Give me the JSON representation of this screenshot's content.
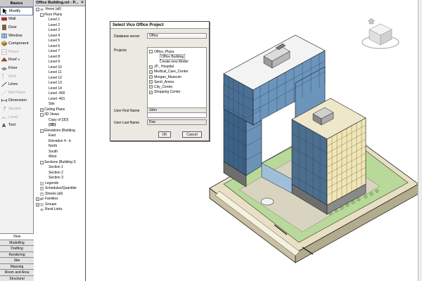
{
  "palette": {
    "header": "Basics",
    "tools": [
      {
        "label": "Modify",
        "icon": "modify-arrow-icon",
        "selected": true,
        "disabled": false
      },
      {
        "label": "Wall",
        "icon": "wall-icon",
        "selected": false,
        "disabled": false
      },
      {
        "label": "Door",
        "icon": "door-icon",
        "selected": false,
        "disabled": false
      },
      {
        "label": "Window",
        "icon": "window-icon",
        "selected": false,
        "disabled": false
      },
      {
        "label": "Component",
        "icon": "component-icon",
        "selected": false,
        "disabled": false
      },
      {
        "label": "Room",
        "icon": "room-icon",
        "selected": false,
        "disabled": true
      },
      {
        "label": "Roof »",
        "icon": "roof-icon",
        "selected": false,
        "disabled": false
      },
      {
        "label": "Floor",
        "icon": "floor-icon",
        "selected": false,
        "disabled": false
      },
      {
        "label": "Grid",
        "icon": "grid-icon",
        "selected": false,
        "disabled": true
      },
      {
        "label": "Lines",
        "icon": "lines-icon",
        "selected": false,
        "disabled": false
      },
      {
        "label": "Ref Plane",
        "icon": "ref-plane-icon",
        "selected": false,
        "disabled": true
      },
      {
        "label": "Dimension",
        "icon": "dimension-icon",
        "selected": false,
        "disabled": false
      },
      {
        "label": "Section",
        "icon": "section-icon",
        "selected": false,
        "disabled": true
      },
      {
        "label": "Level",
        "icon": "level-icon",
        "selected": false,
        "disabled": true
      },
      {
        "label": "Text",
        "icon": "text-icon",
        "selected": false,
        "disabled": false
      }
    ],
    "bottom_tabs": [
      "View",
      "Modelling",
      "Drafting",
      "Rendering",
      "Site",
      "Massing",
      "Room and Area",
      "Structural"
    ],
    "active_tab": "View"
  },
  "browser": {
    "title": "Office Building.rvt - P...",
    "close": "×",
    "items": [
      {
        "label": "Views (all)",
        "indent": 0,
        "exp": "-",
        "icon": "views-icon",
        "bold": false
      },
      {
        "label": "Floor Plans",
        "indent": 1,
        "exp": "-",
        "icon": "",
        "bold": false
      },
      {
        "label": "Level 1",
        "indent": 2,
        "exp": "",
        "icon": "",
        "bold": false
      },
      {
        "label": "Level 2",
        "indent": 2,
        "exp": "",
        "icon": "",
        "bold": false
      },
      {
        "label": "Level 3",
        "indent": 2,
        "exp": "",
        "icon": "",
        "bold": false
      },
      {
        "label": "Level 4",
        "indent": 2,
        "exp": "",
        "icon": "",
        "bold": false
      },
      {
        "label": "Level 5",
        "indent": 2,
        "exp": "",
        "icon": "",
        "bold": false
      },
      {
        "label": "Level 6",
        "indent": 2,
        "exp": "",
        "icon": "",
        "bold": false
      },
      {
        "label": "Level 7",
        "indent": 2,
        "exp": "",
        "icon": "",
        "bold": false
      },
      {
        "label": "Level 8",
        "indent": 2,
        "exp": "",
        "icon": "",
        "bold": false
      },
      {
        "label": "Level 9",
        "indent": 2,
        "exp": "",
        "icon": "",
        "bold": false
      },
      {
        "label": "Level 10",
        "indent": 2,
        "exp": "",
        "icon": "",
        "bold": false
      },
      {
        "label": "Level 11",
        "indent": 2,
        "exp": "",
        "icon": "",
        "bold": false
      },
      {
        "label": "Level 12",
        "indent": 2,
        "exp": "",
        "icon": "",
        "bold": false
      },
      {
        "label": "Level 13",
        "indent": 2,
        "exp": "",
        "icon": "",
        "bold": false
      },
      {
        "label": "Level 14",
        "indent": 2,
        "exp": "",
        "icon": "",
        "bold": false
      },
      {
        "label": "Level -400",
        "indent": 2,
        "exp": "",
        "icon": "",
        "bold": false
      },
      {
        "label": "Level -401",
        "indent": 2,
        "exp": "",
        "icon": "",
        "bold": false
      },
      {
        "label": "Site",
        "indent": 2,
        "exp": "",
        "icon": "",
        "bold": false
      },
      {
        "label": "Ceiling Plans",
        "indent": 1,
        "exp": "+",
        "icon": "",
        "bold": false
      },
      {
        "label": "3D Views",
        "indent": 1,
        "exp": "-",
        "icon": "",
        "bold": false
      },
      {
        "label": "Copy of {3D}",
        "indent": 2,
        "exp": "",
        "icon": "",
        "bold": false
      },
      {
        "label": "{3D}",
        "indent": 2,
        "exp": "",
        "icon": "",
        "bold": true
      },
      {
        "label": "Elevations (Building",
        "indent": 1,
        "exp": "-",
        "icon": "",
        "bold": false
      },
      {
        "label": "East",
        "indent": 2,
        "exp": "",
        "icon": "",
        "bold": false
      },
      {
        "label": "Elevation 4 - b",
        "indent": 2,
        "exp": "",
        "icon": "",
        "bold": false
      },
      {
        "label": "North",
        "indent": 2,
        "exp": "",
        "icon": "",
        "bold": false
      },
      {
        "label": "South",
        "indent": 2,
        "exp": "",
        "icon": "",
        "bold": false
      },
      {
        "label": "West",
        "indent": 2,
        "exp": "",
        "icon": "",
        "bold": false
      },
      {
        "label": "Sections (Building S",
        "indent": 1,
        "exp": "-",
        "icon": "",
        "bold": false
      },
      {
        "label": "Section 1",
        "indent": 2,
        "exp": "",
        "icon": "",
        "bold": false
      },
      {
        "label": "Section 2",
        "indent": 2,
        "exp": "",
        "icon": "",
        "bold": false
      },
      {
        "label": "Section 3",
        "indent": 2,
        "exp": "",
        "icon": "",
        "bold": false
      },
      {
        "label": "Legends",
        "indent": 0,
        "exp": "",
        "icon": "legend-icon",
        "bold": false
      },
      {
        "label": "Schedules/Quantitie",
        "indent": 0,
        "exp": "",
        "icon": "schedule-icon",
        "bold": false
      },
      {
        "label": "Sheets (all)",
        "indent": 0,
        "exp": "",
        "icon": "sheet-icon",
        "bold": false
      },
      {
        "label": "Families",
        "indent": 0,
        "exp": "+",
        "icon": "families-icon",
        "bold": false
      },
      {
        "label": "Groups",
        "indent": 0,
        "exp": "+",
        "icon": "groups-icon",
        "bold": false
      },
      {
        "label": "Revit Links",
        "indent": 0,
        "exp": "",
        "icon": "link-icon",
        "bold": false
      }
    ]
  },
  "dialog": {
    "title": "Select Vico Office Project",
    "server_label": "Database server",
    "server_value": "Office",
    "projects_label": "Projects",
    "projects": [
      {
        "label": "Office_Plaza",
        "level": 0,
        "exp": "-",
        "selected": false
      },
      {
        "label": "Office Building",
        "level": 1,
        "exp": "",
        "selected": true
      },
      {
        "label": "Create new Model",
        "level": 1,
        "exp": "",
        "selected": false
      },
      {
        "label": "JP_ Hospital",
        "level": 0,
        "exp": "+",
        "selected": false
      },
      {
        "label": "Medical_Care_Center",
        "level": 0,
        "exp": "+",
        "selected": false
      },
      {
        "label": "Morgan_Museum",
        "level": 0,
        "exp": "+",
        "selected": false
      },
      {
        "label": "Sport_Arena",
        "level": 0,
        "exp": "+",
        "selected": false
      },
      {
        "label": "City_Center",
        "level": 0,
        "exp": "+",
        "selected": false
      },
      {
        "label": "Shopping Center",
        "level": 0,
        "exp": "+",
        "selected": false
      }
    ],
    "first_name_label": "User First Name",
    "first_name_value": "John",
    "last_name_label": "User Last Name",
    "last_name_value": "Doe",
    "ok_label": "OK",
    "cancel_label": "Cancel"
  },
  "viewcube": {
    "icon": "viewcube-icon",
    "home_icon": "home-icon"
  },
  "colors": {
    "glass": "#5f86ad",
    "glass_dark": "#3d6285",
    "tan_facade": "#f1e6b5",
    "grass": "#b9d99a",
    "ground": "#e9e1c3",
    "base": "#7d7d7d"
  }
}
